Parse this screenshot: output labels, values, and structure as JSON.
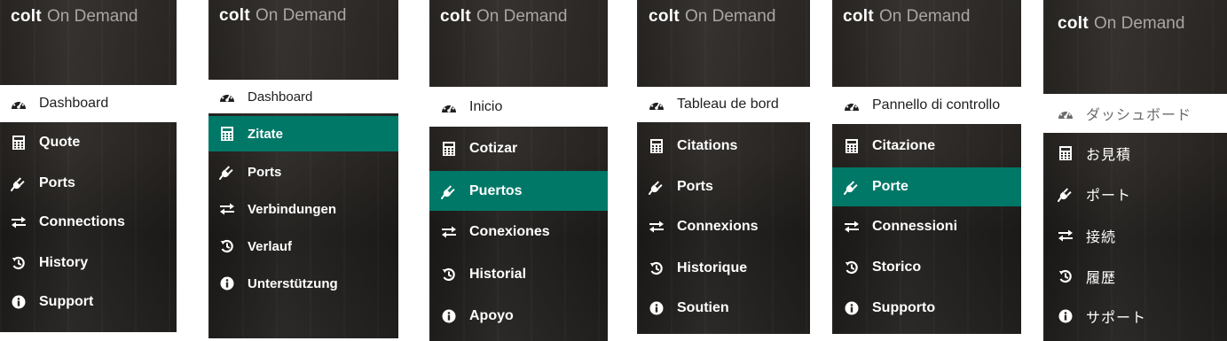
{
  "panels": [
    {
      "brand": {
        "primary": "colt",
        "secondary": "On Demand"
      },
      "items": [
        {
          "icon": "dashboard-icon",
          "label": "Dashboard",
          "state": "active"
        },
        {
          "icon": "calculator-icon",
          "label": "Quote",
          "state": "normal"
        },
        {
          "icon": "plug-icon",
          "label": "Ports",
          "state": "normal"
        },
        {
          "icon": "exchange-arrows-icon",
          "label": "Connections",
          "state": "normal"
        },
        {
          "icon": "history-icon",
          "label": "History",
          "state": "normal"
        },
        {
          "icon": "info-icon",
          "label": "Support",
          "state": "normal"
        }
      ]
    },
    {
      "brand": {
        "primary": "colt",
        "secondary": "On Demand"
      },
      "items": [
        {
          "icon": "dashboard-icon",
          "label": "Dashboard",
          "state": "active"
        },
        {
          "icon": "calculator-icon",
          "label": "Zitate",
          "state": "highlighted"
        },
        {
          "icon": "plug-icon",
          "label": "Ports",
          "state": "normal"
        },
        {
          "icon": "exchange-arrows-icon",
          "label": "Verbindungen",
          "state": "normal"
        },
        {
          "icon": "history-icon",
          "label": "Verlauf",
          "state": "normal"
        },
        {
          "icon": "info-icon",
          "label": "Unterstützung",
          "state": "normal"
        }
      ]
    },
    {
      "brand": {
        "primary": "colt",
        "secondary": "On Demand"
      },
      "items": [
        {
          "icon": "dashboard-icon",
          "label": "Inicio",
          "state": "active"
        },
        {
          "icon": "calculator-icon",
          "label": "Cotizar",
          "state": "normal"
        },
        {
          "icon": "plug-icon",
          "label": "Puertos",
          "state": "highlighted"
        },
        {
          "icon": "exchange-arrows-icon",
          "label": "Conexiones",
          "state": "normal"
        },
        {
          "icon": "history-icon",
          "label": "Historial",
          "state": "normal"
        },
        {
          "icon": "info-icon",
          "label": "Apoyo",
          "state": "normal"
        }
      ]
    },
    {
      "brand": {
        "primary": "colt",
        "secondary": "On Demand"
      },
      "items": [
        {
          "icon": "dashboard-icon",
          "label": "Tableau de bord",
          "state": "active"
        },
        {
          "icon": "calculator-icon",
          "label": "Citations",
          "state": "normal"
        },
        {
          "icon": "plug-icon",
          "label": "Ports",
          "state": "normal"
        },
        {
          "icon": "exchange-arrows-icon",
          "label": "Connexions",
          "state": "normal"
        },
        {
          "icon": "history-icon",
          "label": "Historique",
          "state": "normal"
        },
        {
          "icon": "info-icon",
          "label": "Soutien",
          "state": "normal"
        }
      ]
    },
    {
      "brand": {
        "primary": "colt",
        "secondary": "On Demand"
      },
      "items": [
        {
          "icon": "dashboard-icon",
          "label": "Pannello di controllo",
          "state": "active"
        },
        {
          "icon": "calculator-icon",
          "label": "Citazione",
          "state": "normal"
        },
        {
          "icon": "plug-icon",
          "label": "Porte",
          "state": "highlighted"
        },
        {
          "icon": "exchange-arrows-icon",
          "label": "Connessioni",
          "state": "normal"
        },
        {
          "icon": "history-icon",
          "label": "Storico",
          "state": "normal"
        },
        {
          "icon": "info-icon",
          "label": "Supporto",
          "state": "normal"
        }
      ]
    },
    {
      "brand": {
        "primary": "colt",
        "secondary": "On Demand"
      },
      "items": [
        {
          "icon": "dashboard-icon",
          "label": "ダッシュボード",
          "state": "active"
        },
        {
          "icon": "calculator-icon",
          "label": "お見積",
          "state": "normal"
        },
        {
          "icon": "plug-icon",
          "label": "ポート",
          "state": "normal"
        },
        {
          "icon": "exchange-arrows-icon",
          "label": "接続",
          "state": "normal"
        },
        {
          "icon": "history-icon",
          "label": "履歴",
          "state": "normal"
        },
        {
          "icon": "info-icon",
          "label": "サポート",
          "state": "normal"
        }
      ]
    }
  ],
  "colors": {
    "highlight": "#007868",
    "active_background": "#ffffff",
    "panel_background": "#2b2825",
    "brand_primary": "#ffffff",
    "brand_secondary": "#a9a7a4"
  }
}
